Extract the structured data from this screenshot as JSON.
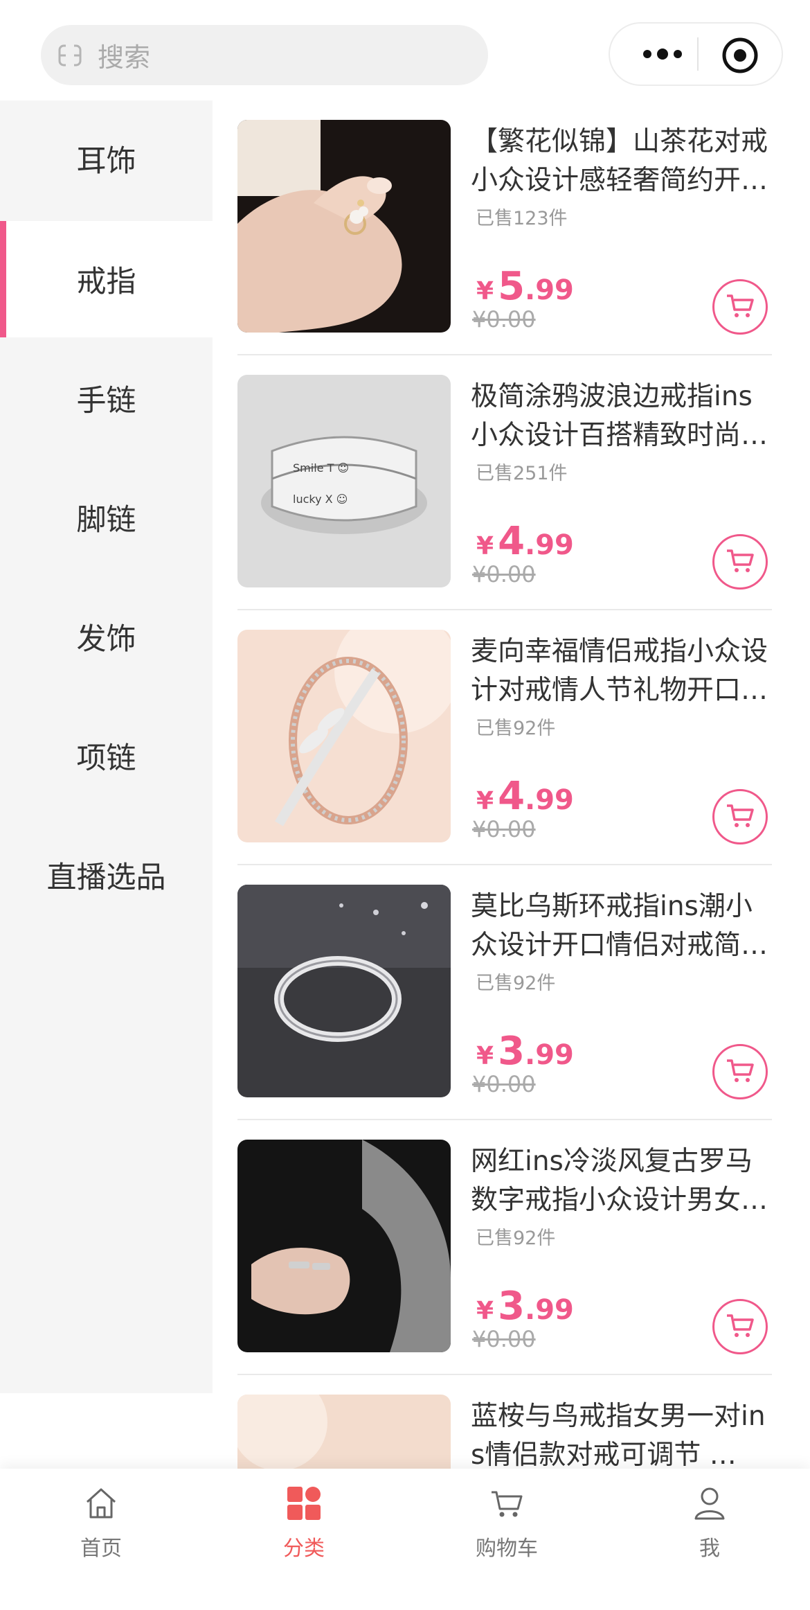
{
  "search": {
    "placeholder": "搜索"
  },
  "colors": {
    "accent": "#f0588a",
    "tab_active": "#f05a5a"
  },
  "categories": [
    {
      "label": "耳饰"
    },
    {
      "label": "戒指",
      "active": true
    },
    {
      "label": "手链"
    },
    {
      "label": "脚链"
    },
    {
      "label": "发饰"
    },
    {
      "label": "项链"
    },
    {
      "label": "直播选品"
    }
  ],
  "products": [
    {
      "title": "【繁花似锦】山茶花对戒小众设计感轻奢简约开口戒指",
      "sold": "已售123件",
      "currency": "¥",
      "price_int": "5",
      "price_dec": ".99",
      "original": "¥0.00"
    },
    {
      "title": "极简涂鸦波浪边戒指ins小众设计百搭精致时尚食指戒",
      "sold": "已售251件",
      "currency": "¥",
      "price_int": "4",
      "price_dec": ".99",
      "original": "¥0.00"
    },
    {
      "title": "麦向幸福情侣戒指小众设计对戒情人节礼物开口可调节",
      "sold": "已售92件",
      "currency": "¥",
      "price_int": "4",
      "price_dec": ".99",
      "original": "¥0.00"
    },
    {
      "title": "莫比乌斯环戒指ins潮小众设计开口情侣对戒简约百搭",
      "sold": "已售92件",
      "currency": "¥",
      "price_int": "3",
      "price_dec": ".99",
      "original": "¥0.00"
    },
    {
      "title": "网红ins冷淡风复古罗马数字戒指小众设计男女情侣款",
      "sold": "已售92件",
      "currency": "¥",
      "price_int": "3",
      "price_dec": ".99",
      "original": "¥0.00"
    },
    {
      "title": "蓝桉与鸟戒指女男一对ins情侣款对戒可调节 …",
      "sold": "",
      "currency": "¥",
      "price_int": "",
      "price_dec": "",
      "original": ""
    }
  ],
  "tabs": [
    {
      "label": "首页",
      "icon": "home-icon"
    },
    {
      "label": "分类",
      "icon": "category-icon",
      "active": true
    },
    {
      "label": "购物车",
      "icon": "cart-icon"
    },
    {
      "label": "我",
      "icon": "user-icon"
    }
  ]
}
